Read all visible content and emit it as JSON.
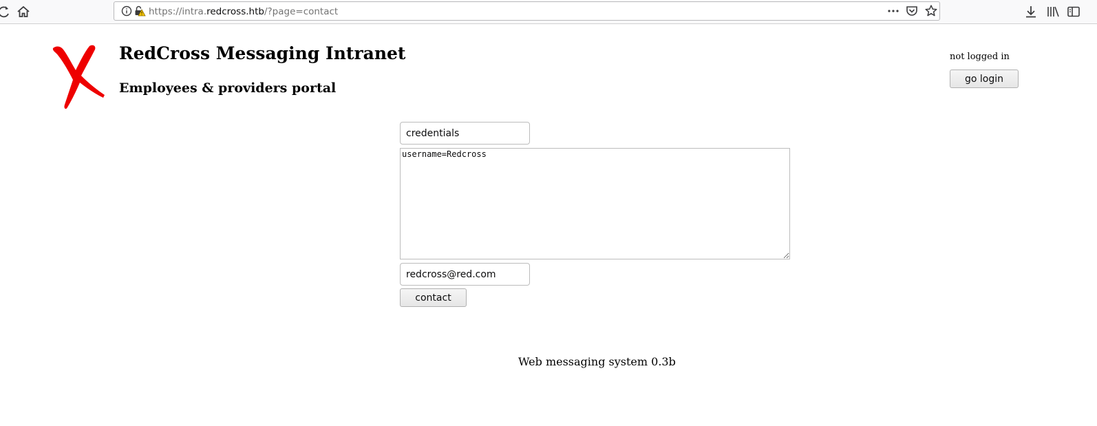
{
  "browser": {
    "url_prefix": "https://intra.",
    "url_host": "redcross.htb",
    "url_path": "/?page=contact"
  },
  "header": {
    "title": "RedCross Messaging Intranet",
    "subtitle": "Employees & providers portal",
    "logo_color": "#ee0000"
  },
  "session": {
    "status": "not logged in",
    "login_label": "go login"
  },
  "contact_form": {
    "subject_value": "credentials",
    "message_value": "username=Redcross",
    "email_value": "redcross@red.com",
    "submit_label": "contact"
  },
  "footer": {
    "text": "Web messaging system 0.3b"
  }
}
